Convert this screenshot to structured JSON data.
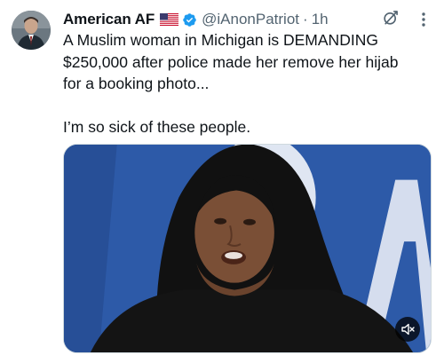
{
  "tweet": {
    "display_name": "American AF",
    "flag": "us-flag-emoji",
    "verified": "verified-badge-icon",
    "handle": "@iAnonPatriot",
    "separator": "·",
    "time": "1h",
    "text": "A Muslim woman in Michigan is DEMANDING $250,000 after police made her remove her hijab for a booking photo...\n\nI’m so sick of these people.",
    "icons": {
      "grok": "grok-icon",
      "more": "more-icon",
      "mute": "volume-mute-icon"
    },
    "colors": {
      "accent": "#1d9bf0",
      "secondary_text": "#536471",
      "text": "#0f1419"
    }
  }
}
